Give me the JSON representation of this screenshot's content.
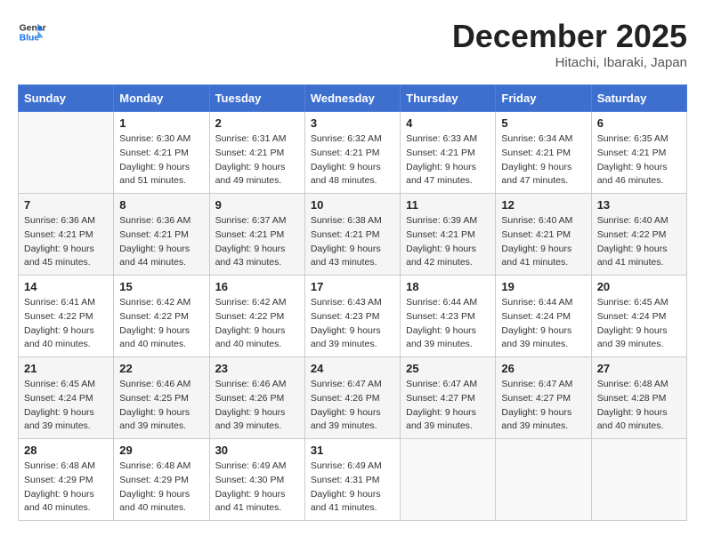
{
  "header": {
    "logo_line1": "General",
    "logo_line2": "Blue",
    "month_title": "December 2025",
    "location": "Hitachi, Ibaraki, Japan"
  },
  "weekdays": [
    "Sunday",
    "Monday",
    "Tuesday",
    "Wednesday",
    "Thursday",
    "Friday",
    "Saturday"
  ],
  "weeks": [
    [
      {
        "day": "",
        "info": ""
      },
      {
        "day": "1",
        "info": "Sunrise: 6:30 AM\nSunset: 4:21 PM\nDaylight: 9 hours\nand 51 minutes."
      },
      {
        "day": "2",
        "info": "Sunrise: 6:31 AM\nSunset: 4:21 PM\nDaylight: 9 hours\nand 49 minutes."
      },
      {
        "day": "3",
        "info": "Sunrise: 6:32 AM\nSunset: 4:21 PM\nDaylight: 9 hours\nand 48 minutes."
      },
      {
        "day": "4",
        "info": "Sunrise: 6:33 AM\nSunset: 4:21 PM\nDaylight: 9 hours\nand 47 minutes."
      },
      {
        "day": "5",
        "info": "Sunrise: 6:34 AM\nSunset: 4:21 PM\nDaylight: 9 hours\nand 47 minutes."
      },
      {
        "day": "6",
        "info": "Sunrise: 6:35 AM\nSunset: 4:21 PM\nDaylight: 9 hours\nand 46 minutes."
      }
    ],
    [
      {
        "day": "7",
        "info": "Sunrise: 6:36 AM\nSunset: 4:21 PM\nDaylight: 9 hours\nand 45 minutes."
      },
      {
        "day": "8",
        "info": "Sunrise: 6:36 AM\nSunset: 4:21 PM\nDaylight: 9 hours\nand 44 minutes."
      },
      {
        "day": "9",
        "info": "Sunrise: 6:37 AM\nSunset: 4:21 PM\nDaylight: 9 hours\nand 43 minutes."
      },
      {
        "day": "10",
        "info": "Sunrise: 6:38 AM\nSunset: 4:21 PM\nDaylight: 9 hours\nand 43 minutes."
      },
      {
        "day": "11",
        "info": "Sunrise: 6:39 AM\nSunset: 4:21 PM\nDaylight: 9 hours\nand 42 minutes."
      },
      {
        "day": "12",
        "info": "Sunrise: 6:40 AM\nSunset: 4:21 PM\nDaylight: 9 hours\nand 41 minutes."
      },
      {
        "day": "13",
        "info": "Sunrise: 6:40 AM\nSunset: 4:22 PM\nDaylight: 9 hours\nand 41 minutes."
      }
    ],
    [
      {
        "day": "14",
        "info": "Sunrise: 6:41 AM\nSunset: 4:22 PM\nDaylight: 9 hours\nand 40 minutes."
      },
      {
        "day": "15",
        "info": "Sunrise: 6:42 AM\nSunset: 4:22 PM\nDaylight: 9 hours\nand 40 minutes."
      },
      {
        "day": "16",
        "info": "Sunrise: 6:42 AM\nSunset: 4:22 PM\nDaylight: 9 hours\nand 40 minutes."
      },
      {
        "day": "17",
        "info": "Sunrise: 6:43 AM\nSunset: 4:23 PM\nDaylight: 9 hours\nand 39 minutes."
      },
      {
        "day": "18",
        "info": "Sunrise: 6:44 AM\nSunset: 4:23 PM\nDaylight: 9 hours\nand 39 minutes."
      },
      {
        "day": "19",
        "info": "Sunrise: 6:44 AM\nSunset: 4:24 PM\nDaylight: 9 hours\nand 39 minutes."
      },
      {
        "day": "20",
        "info": "Sunrise: 6:45 AM\nSunset: 4:24 PM\nDaylight: 9 hours\nand 39 minutes."
      }
    ],
    [
      {
        "day": "21",
        "info": "Sunrise: 6:45 AM\nSunset: 4:24 PM\nDaylight: 9 hours\nand 39 minutes."
      },
      {
        "day": "22",
        "info": "Sunrise: 6:46 AM\nSunset: 4:25 PM\nDaylight: 9 hours\nand 39 minutes."
      },
      {
        "day": "23",
        "info": "Sunrise: 6:46 AM\nSunset: 4:26 PM\nDaylight: 9 hours\nand 39 minutes."
      },
      {
        "day": "24",
        "info": "Sunrise: 6:47 AM\nSunset: 4:26 PM\nDaylight: 9 hours\nand 39 minutes."
      },
      {
        "day": "25",
        "info": "Sunrise: 6:47 AM\nSunset: 4:27 PM\nDaylight: 9 hours\nand 39 minutes."
      },
      {
        "day": "26",
        "info": "Sunrise: 6:47 AM\nSunset: 4:27 PM\nDaylight: 9 hours\nand 39 minutes."
      },
      {
        "day": "27",
        "info": "Sunrise: 6:48 AM\nSunset: 4:28 PM\nDaylight: 9 hours\nand 40 minutes."
      }
    ],
    [
      {
        "day": "28",
        "info": "Sunrise: 6:48 AM\nSunset: 4:29 PM\nDaylight: 9 hours\nand 40 minutes."
      },
      {
        "day": "29",
        "info": "Sunrise: 6:48 AM\nSunset: 4:29 PM\nDaylight: 9 hours\nand 40 minutes."
      },
      {
        "day": "30",
        "info": "Sunrise: 6:49 AM\nSunset: 4:30 PM\nDaylight: 9 hours\nand 41 minutes."
      },
      {
        "day": "31",
        "info": "Sunrise: 6:49 AM\nSunset: 4:31 PM\nDaylight: 9 hours\nand 41 minutes."
      },
      {
        "day": "",
        "info": ""
      },
      {
        "day": "",
        "info": ""
      },
      {
        "day": "",
        "info": ""
      }
    ]
  ]
}
